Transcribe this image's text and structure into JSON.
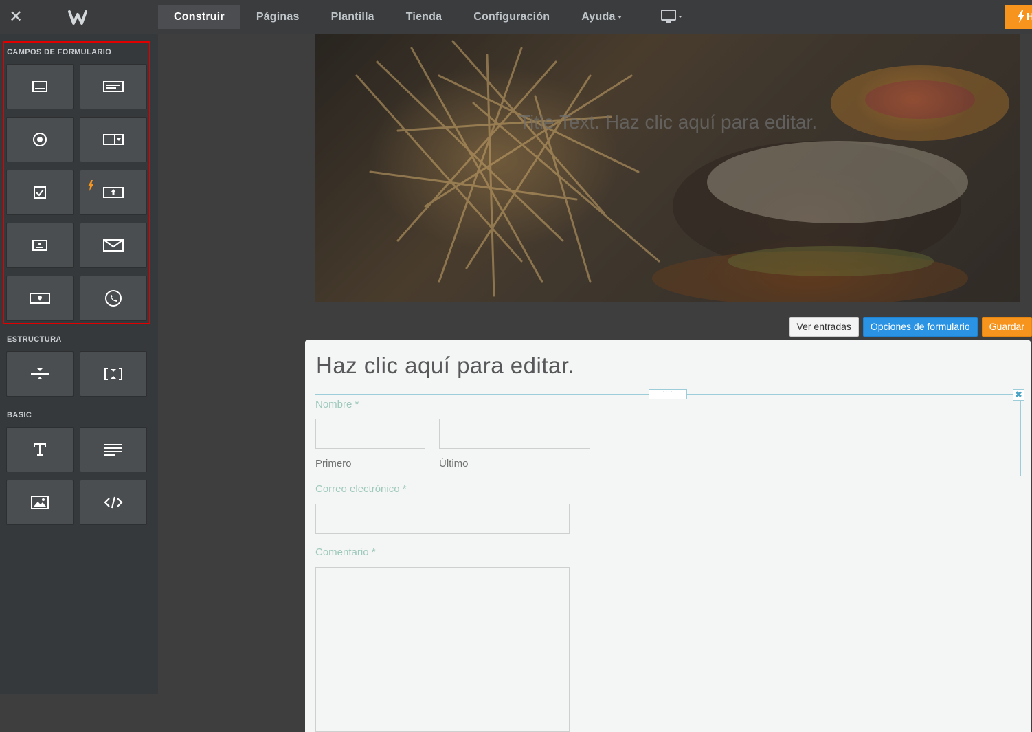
{
  "topbar": {
    "close": "✕",
    "tabs": [
      {
        "label": "Construir",
        "active": true
      },
      {
        "label": "Páginas"
      },
      {
        "label": "Plantilla"
      },
      {
        "label": "Tienda"
      },
      {
        "label": "Configuración"
      },
      {
        "label": "Ayuda"
      }
    ],
    "upgrade_label": "H"
  },
  "sidebar": {
    "form_fields_label": "CAMPOS DE FORMULARIO",
    "structure_label": "ESTRUCTURA",
    "basic_label": "BASIC"
  },
  "hero": {
    "title": "Title Text. Haz clic aquí para editar."
  },
  "form_actions": {
    "view_entries": "Ver entradas",
    "form_options": "Opciones de formulario",
    "save": "Guardar"
  },
  "form": {
    "title": "Haz clic aquí para editar.",
    "name_label": "Nombre *",
    "first_label": "Primero",
    "last_label": "Último",
    "email_label": "Correo electrónico *",
    "comment_label": "Comentario *",
    "drag_handle": "::::"
  },
  "colors": {
    "accent_orange": "#f7941d",
    "accent_blue": "#2a93e4",
    "highlight_red": "#e00000",
    "label_green": "#9fc9bd"
  }
}
